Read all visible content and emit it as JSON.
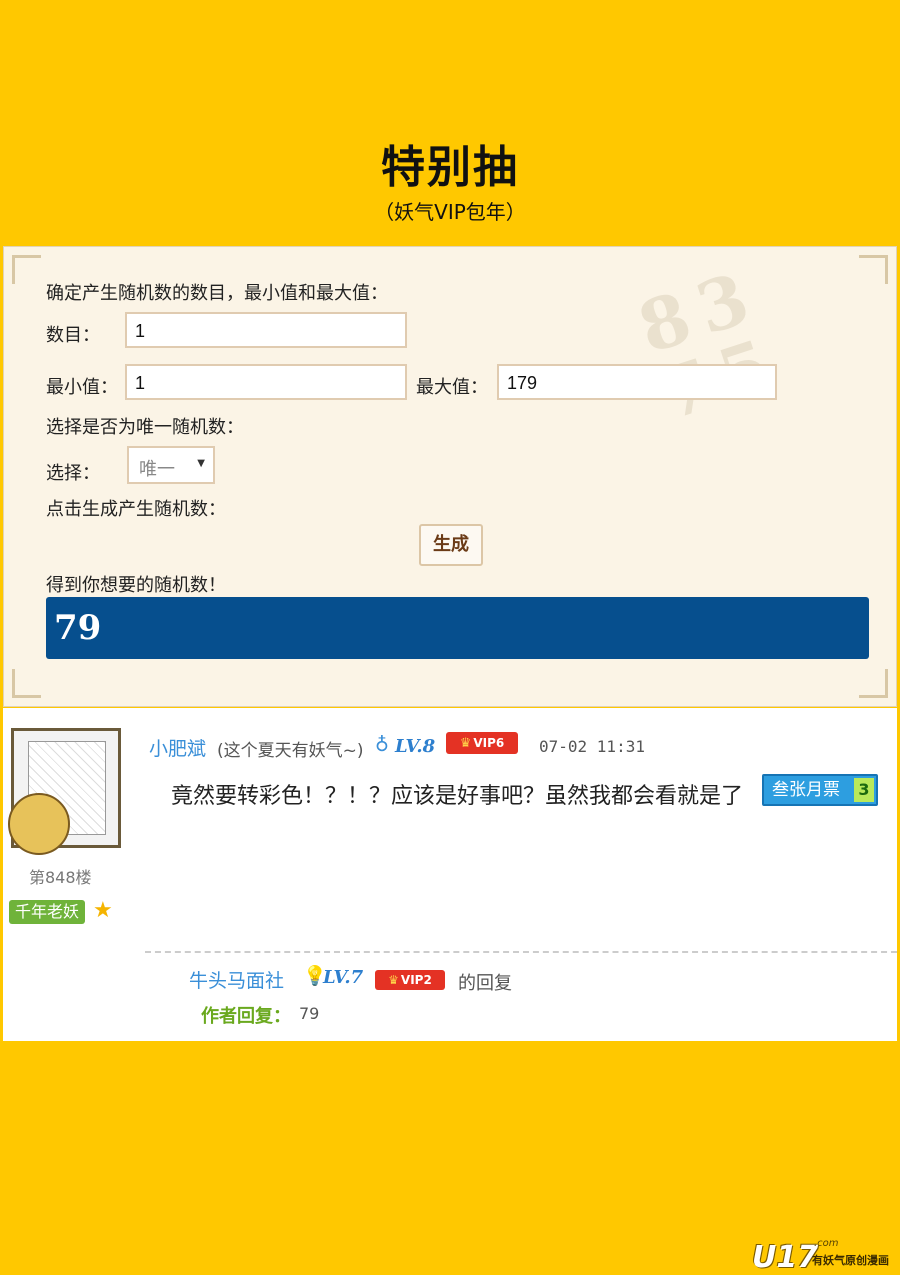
{
  "header": {
    "title": "特别抽",
    "subtitle": "（妖气VIP包年）"
  },
  "generator": {
    "instruction": "确定产生随机数的数目，最小值和最大值：",
    "count_label": "数目：",
    "count_value": "1",
    "min_label": "最小值：",
    "min_value": "1",
    "max_label": "最大值：",
    "max_value": "179",
    "unique_instruction": "选择是否为唯一随机数：",
    "select_label": "选择：",
    "select_value": "唯一",
    "generate_instruction": "点击生成产生随机数：",
    "generate_button": "生成",
    "result_label": "得到你想要的随机数！",
    "result_value": "79"
  },
  "comment": {
    "floor": "第848楼",
    "rank": "千年老妖",
    "username": "小肥斌",
    "signature": "(这个夏天有妖气~)",
    "level": "LV.8",
    "vip": "VIP6",
    "time": "07-02  11:31",
    "text": "竟然要转彩色！？！？应该是好事吧？虽然我都会看就是了",
    "ticket_label": "叁张月票",
    "ticket_count": "3",
    "reply": {
      "username": "牛头马面社",
      "level": "LV.7",
      "vip": "VIP2",
      "suffix": "的回复",
      "label": "作者回复：",
      "value": "79"
    }
  },
  "logo": {
    "main": "U17",
    "domain": ".com",
    "tagline": "有妖气原创漫画"
  },
  "colors": {
    "background": "#ffc800",
    "result_bg": "#064f8e",
    "link_blue": "#3a8fd8",
    "vip_red": "#e43224"
  }
}
